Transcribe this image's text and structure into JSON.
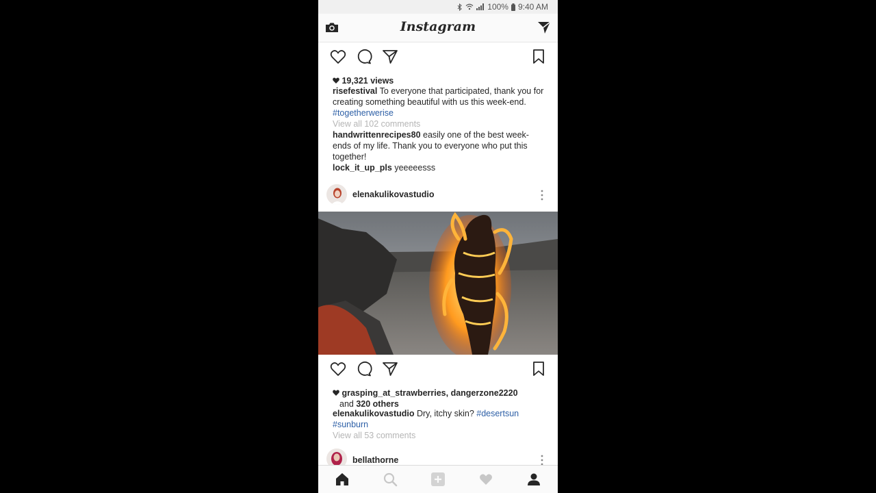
{
  "status_bar": {
    "battery": "100%",
    "time": "9:40 AM"
  },
  "app": {
    "title": "Instagram"
  },
  "post1": {
    "views": "19,321 views",
    "caption_user": "risefestival",
    "caption_text": " To everyone that participated, thank you for creating something beautiful with us this week-end. ",
    "caption_tag": "#togetherwerise",
    "view_comments": "View all 102 comments",
    "comments": [
      {
        "user": "handwrittenrecipes80",
        "text": " easily one of the best week-ends of my life. Thank you to everyone who put this together!"
      },
      {
        "user": "lock_it_up_pls",
        "text": " yeeeeesss"
      }
    ]
  },
  "post2": {
    "username": "elenakulikovastudio",
    "likes_names": "grasping_at_strawberries, dangerzone2220",
    "likes_and": "and ",
    "likes_others": "320 others",
    "caption_user": "elenakulikovastudio",
    "caption_text": " Dry, itchy skin? ",
    "caption_tag1": "#desertsun",
    "caption_tag2": "#sunburn",
    "view_comments": "View all 53 comments"
  },
  "post3": {
    "username": "bellathorne"
  },
  "colors": {
    "hashtag": "#2d5fa6",
    "muted": "#b5b5b5",
    "text": "#262626"
  },
  "icons": {
    "top": [
      "camera-icon",
      "direct-message-icon"
    ],
    "actions": [
      "heart-icon",
      "comment-icon",
      "share-icon",
      "bookmark-icon"
    ],
    "nav": [
      "home-icon",
      "search-icon",
      "add-icon",
      "activity-heart-icon",
      "profile-icon"
    ]
  }
}
